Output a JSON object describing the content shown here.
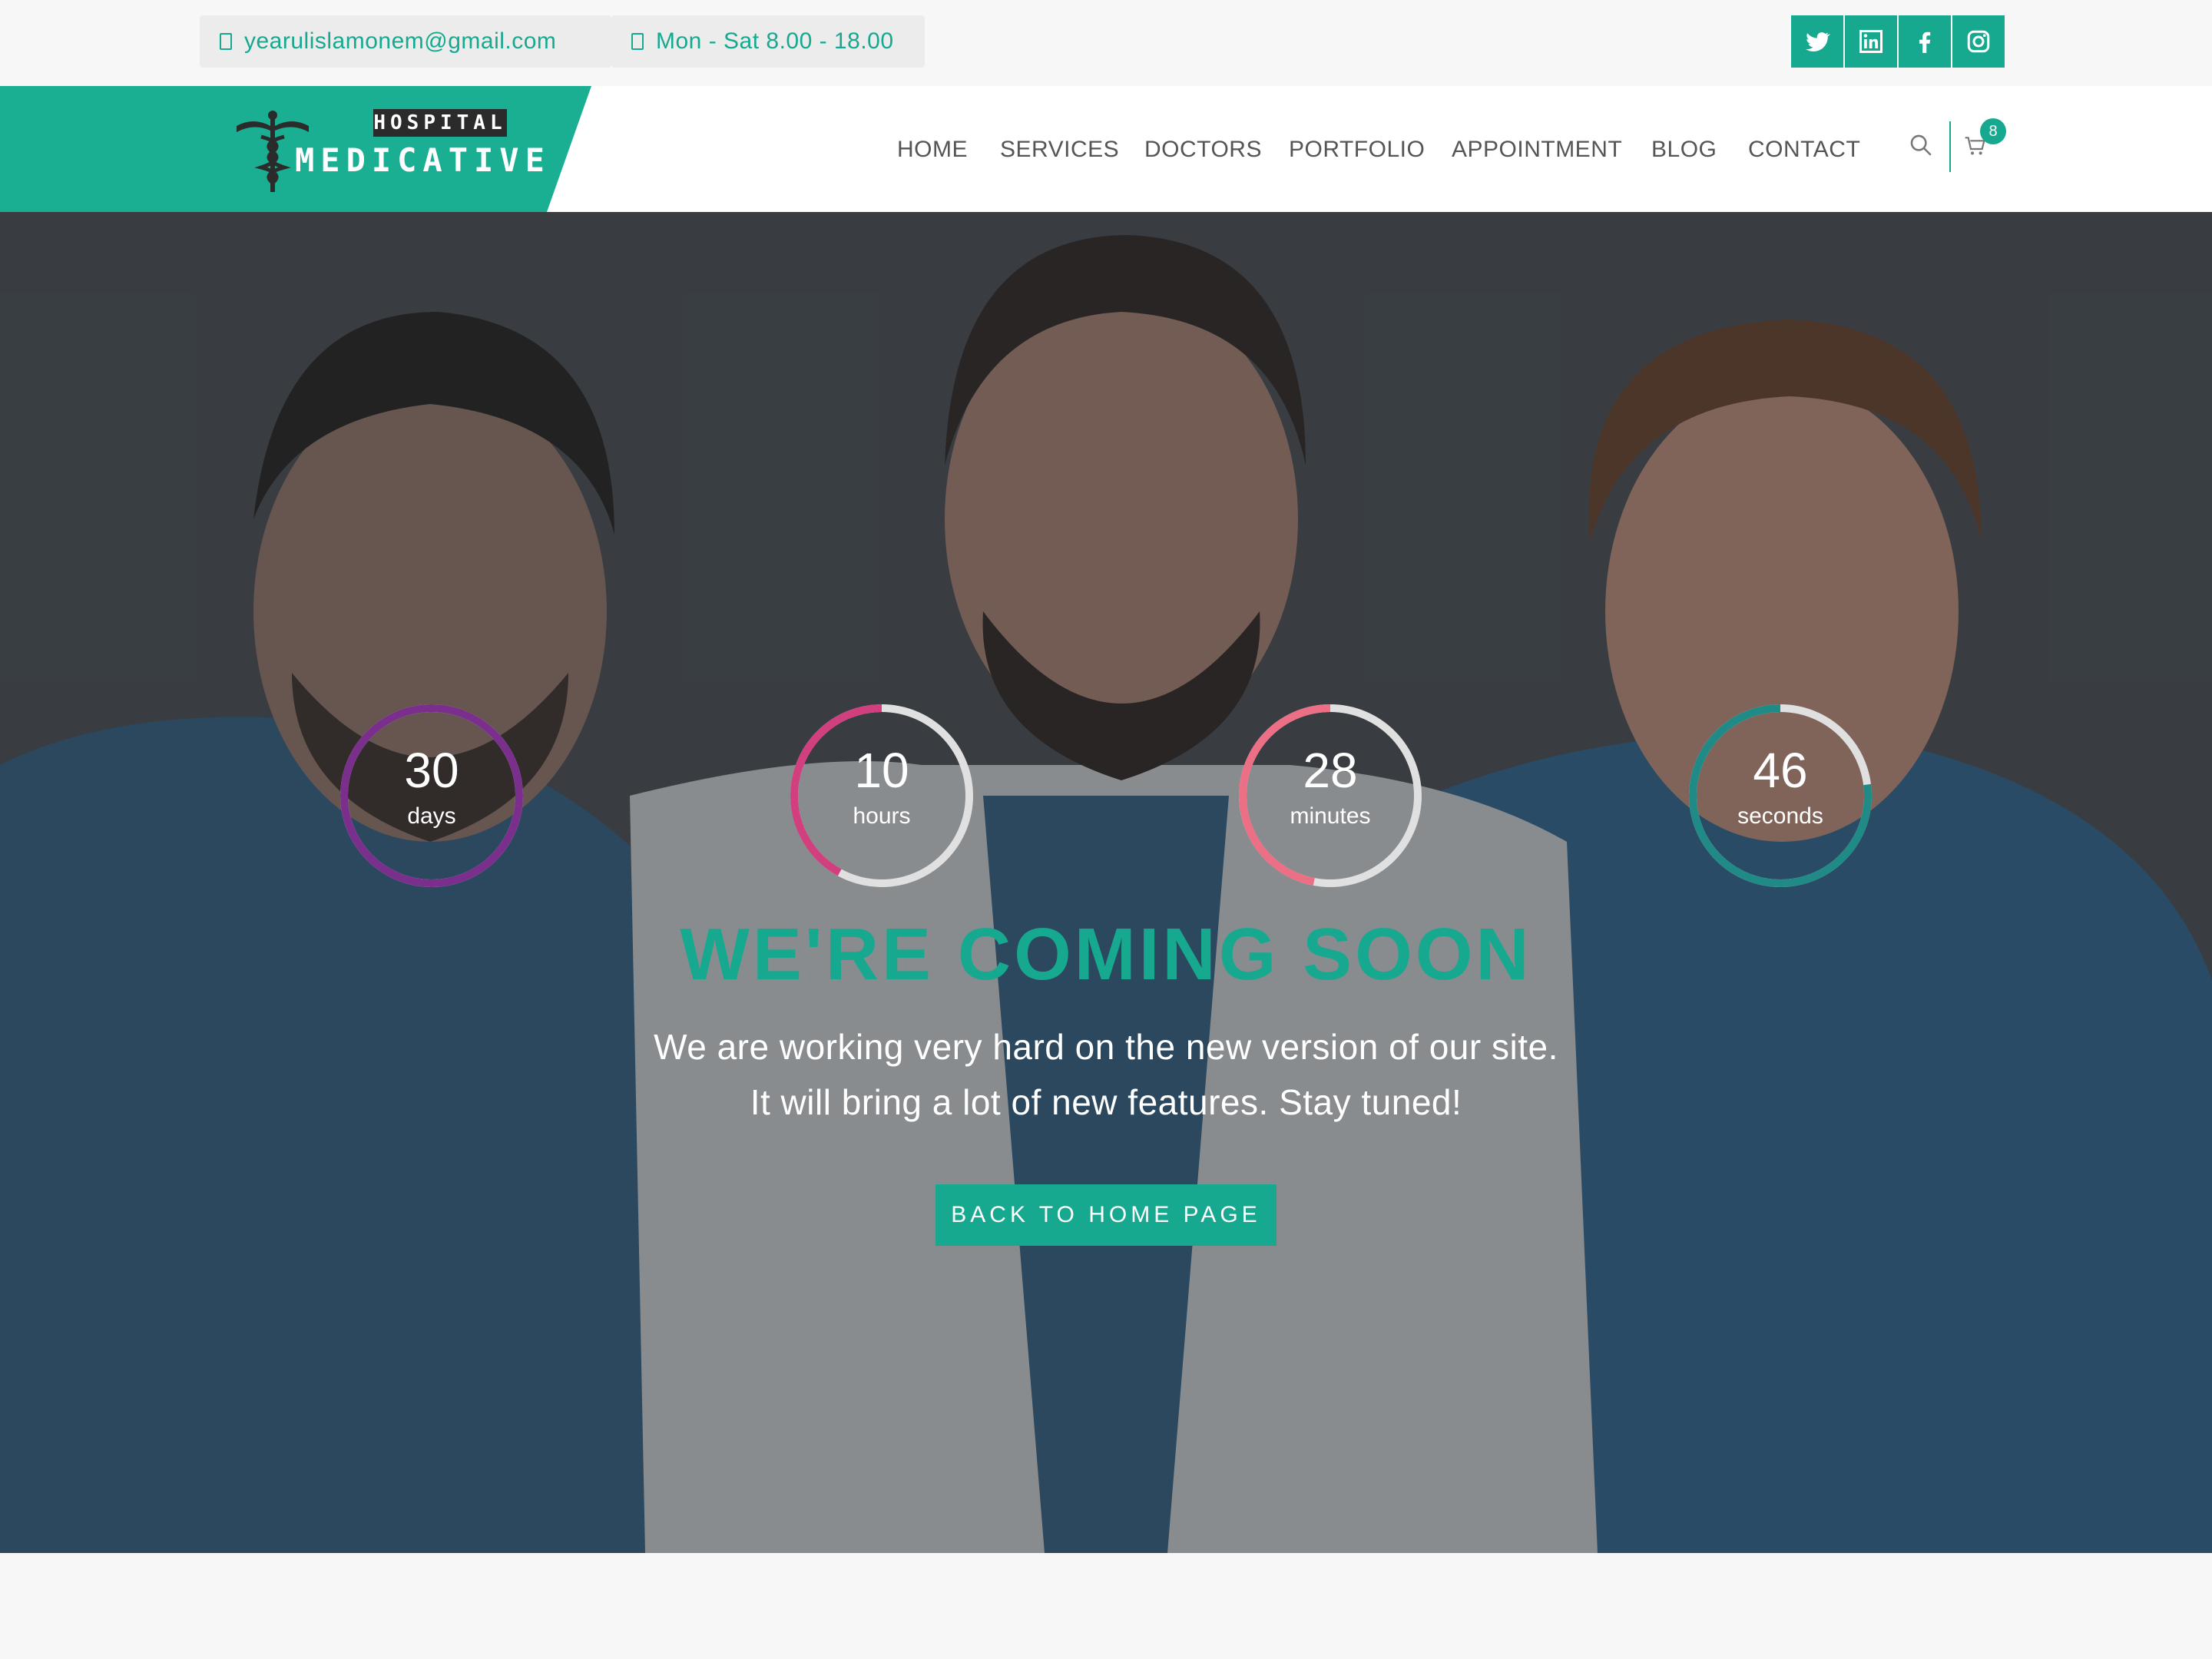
{
  "topbar": {
    "email": "yearulislamonem@gmail.com",
    "hours": "Mon - Sat 8.00 - 18.00",
    "social": [
      {
        "icon": "twitter-icon"
      },
      {
        "icon": "linkedin-icon"
      },
      {
        "icon": "facebook-icon"
      },
      {
        "icon": "instagram-icon"
      }
    ]
  },
  "logo": {
    "top": "HOSPITAL",
    "main": "MEDICATIVE"
  },
  "nav": {
    "items": [
      "HOME",
      "SERVICES",
      "DOCTORS",
      "PORTFOLIO",
      "APPOINTMENT",
      "BLOG",
      "CONTACT"
    ],
    "cart_count": "8"
  },
  "countdown": [
    {
      "value": "30",
      "label": "days",
      "color": "#7b2f8c",
      "progress": 1.0
    },
    {
      "value": "10",
      "label": "hours",
      "color": "#d13f7e",
      "progress": 0.42
    },
    {
      "value": "28",
      "label": "minutes",
      "color": "#ec6f86",
      "progress": 0.47
    },
    {
      "value": "46",
      "label": "seconds",
      "color": "#1f8a86",
      "progress": 0.77
    }
  ],
  "hero": {
    "headline": "WE'RE COMING SOON",
    "line1": "We are working very hard on the new version of our site.",
    "line2": "It will bring a lot of new features. Stay tuned!",
    "button": "BACK TO HOME PAGE"
  },
  "colors": {
    "accent": "#17a98f",
    "track": "#e0e0e0"
  }
}
